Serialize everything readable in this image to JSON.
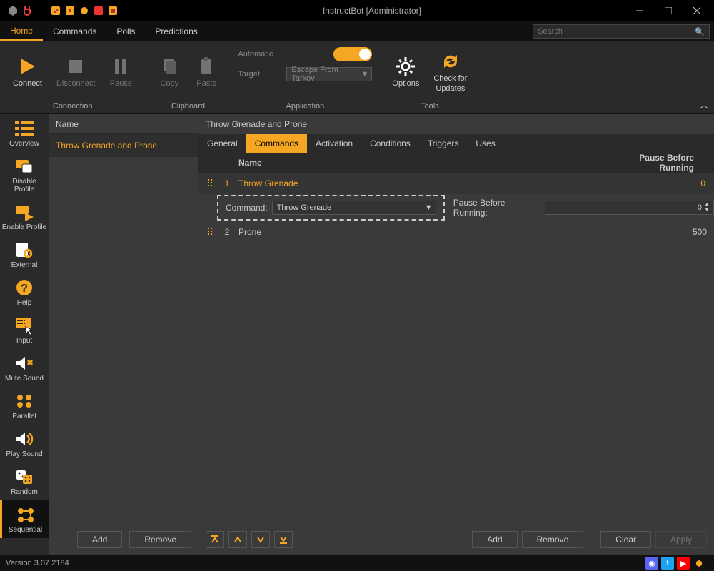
{
  "window": {
    "title": "InstructBot [Administrator]"
  },
  "menubar": {
    "items": [
      "Home",
      "Commands",
      "Polls",
      "Predictions"
    ],
    "active": 0,
    "search_placeholder": "Search"
  },
  "ribbon": {
    "connection": {
      "label": "Connection",
      "connect": "Connect",
      "disconnect": "Disconnect",
      "pause": "Pause"
    },
    "clipboard": {
      "label": "Clipboard",
      "copy": "Copy",
      "paste": "Paste"
    },
    "application": {
      "label": "Application",
      "automatic_label": "Automatic",
      "target_label": "Target",
      "target_value": "Escape From Tarkov"
    },
    "tools": {
      "label": "Tools",
      "options": "Options",
      "check_updates": "Check for\nUpdates"
    }
  },
  "left_tools": [
    {
      "id": "overview",
      "label": "Overview"
    },
    {
      "id": "disable-profile",
      "label": "Disable Profile"
    },
    {
      "id": "enable-profile",
      "label": "Enable Profile"
    },
    {
      "id": "external",
      "label": "External"
    },
    {
      "id": "help",
      "label": "Help"
    },
    {
      "id": "input",
      "label": "Input"
    },
    {
      "id": "mute-sound",
      "label": "Mute Sound"
    },
    {
      "id": "parallel",
      "label": "Parallel"
    },
    {
      "id": "play-sound",
      "label": "Play Sound"
    },
    {
      "id": "random",
      "label": "Random"
    },
    {
      "id": "sequential",
      "label": "Sequential"
    }
  ],
  "name_col": {
    "header": "Name",
    "items": [
      "Throw Grenade and Prone"
    ],
    "add": "Add",
    "remove": "Remove"
  },
  "detail": {
    "title": "Throw Grenade and Prone",
    "tabs": [
      "General",
      "Commands",
      "Activation",
      "Conditions",
      "Triggers",
      "Uses"
    ],
    "active_tab": 1,
    "grid": {
      "headers": {
        "name": "Name",
        "pause": "Pause Before Running"
      },
      "rows": [
        {
          "num": "1",
          "name": "Throw Grenade",
          "pbr": "0",
          "selected": true
        },
        {
          "num": "2",
          "name": "Prone",
          "pbr": "500",
          "selected": false
        }
      ],
      "expand": {
        "command_label": "Command:",
        "command_value": "Throw Grenade",
        "pause_label": "Pause Before Running:",
        "pause_value": "0"
      }
    },
    "footer": {
      "add": "Add",
      "remove": "Remove",
      "clear": "Clear",
      "apply": "Apply"
    }
  },
  "statusbar": {
    "version": "Version 3.07.2184"
  },
  "colors": {
    "accent": "#f5a623"
  }
}
